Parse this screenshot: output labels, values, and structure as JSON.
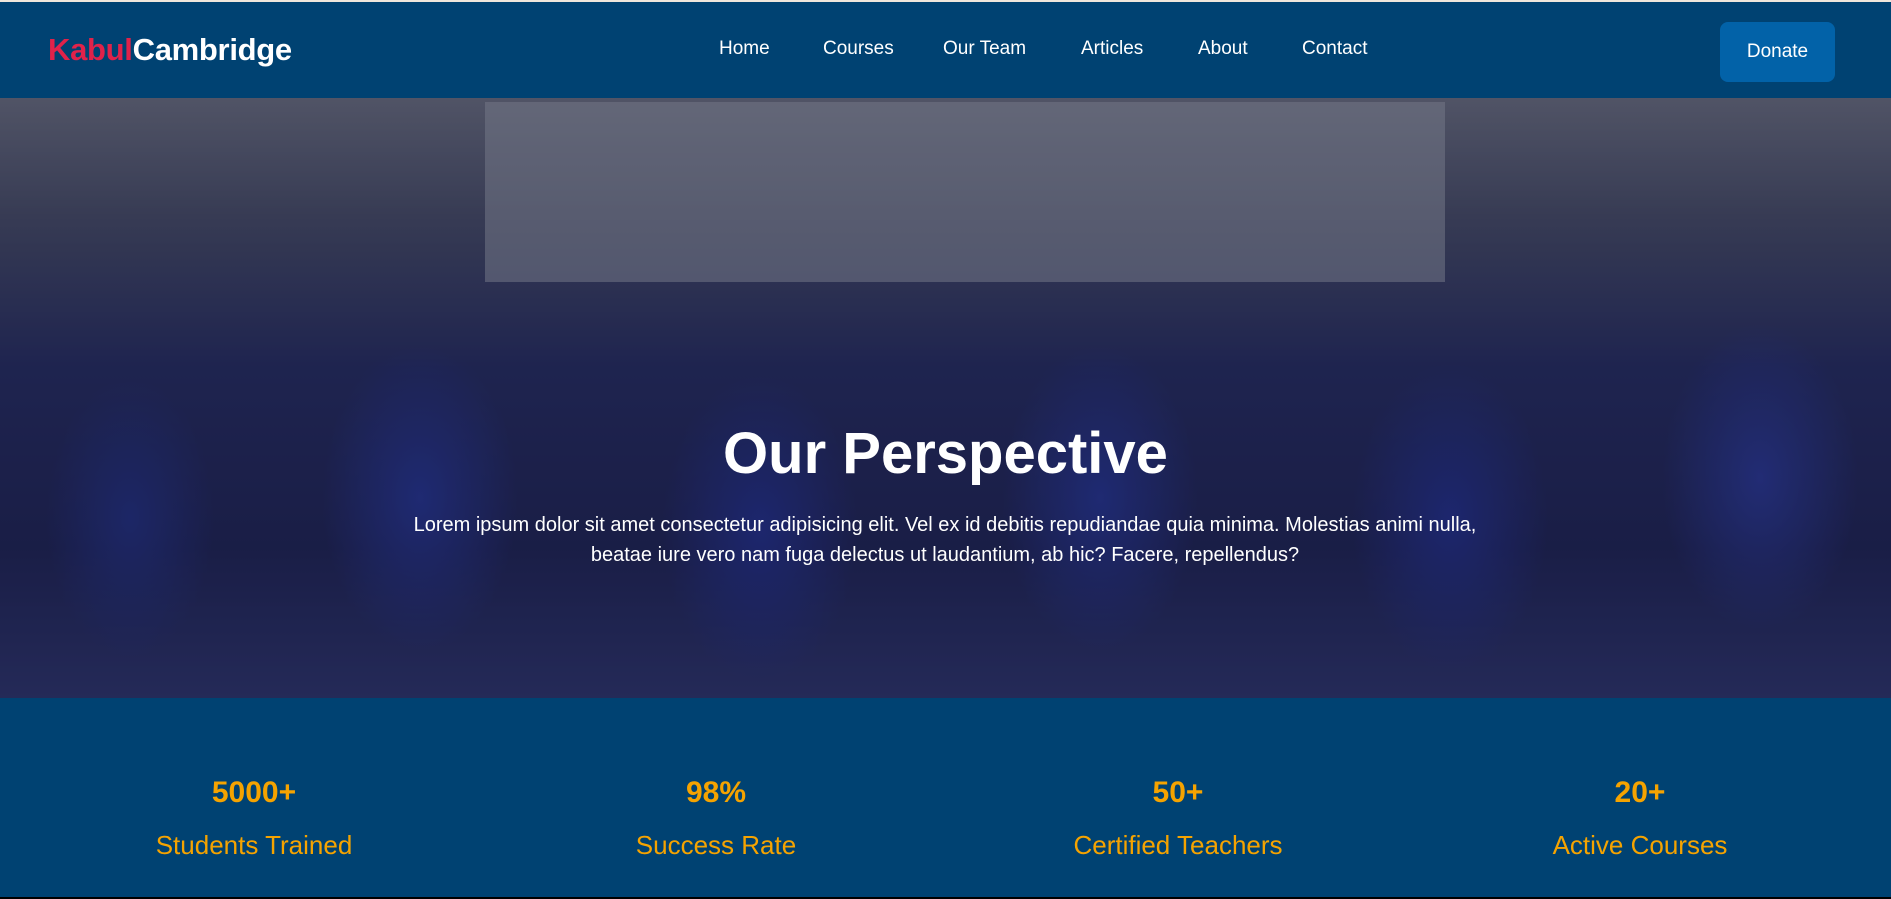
{
  "brand": {
    "part1": "Kabul",
    "part2": "Cambridge",
    "color1": "#e0224a",
    "color2": "#ffffff"
  },
  "nav": {
    "items": [
      "Home",
      "Courses",
      "Our Team",
      "Articles",
      "About",
      "Contact"
    ],
    "donate": "Donate"
  },
  "hero": {
    "title": "Our Perspective",
    "text": "Lorem ipsum dolor sit amet consectetur adipisicing elit. Vel ex id debitis repudiandae quia minima. Molestias animi nulla, beatae iure vero nam fuga delectus ut laudantium, ab hic? Facere, repellendus?"
  },
  "stats": [
    {
      "value": "5000+",
      "label": "Students Trained"
    },
    {
      "value": "98%",
      "label": "Success Rate"
    },
    {
      "value": "50+",
      "label": "Certified Teachers"
    },
    {
      "value": "20+",
      "label": "Active Courses"
    }
  ],
  "colors": {
    "nav_bg": "#004272",
    "accent": "#f5a300",
    "button": "#0262a8"
  }
}
